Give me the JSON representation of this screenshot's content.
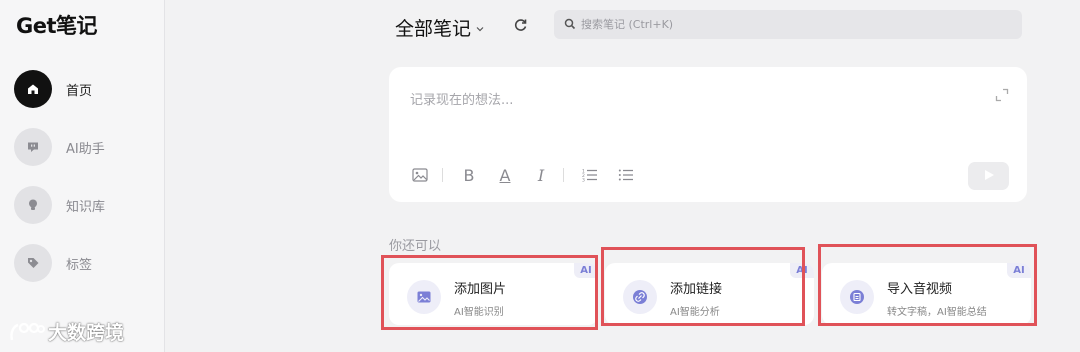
{
  "app": {
    "logo_text": "Get笔记"
  },
  "sidebar": {
    "items": [
      {
        "label": "首页",
        "icon": "home-icon",
        "active": true
      },
      {
        "label": "AI助手",
        "icon": "chat-bot-icon",
        "active": false
      },
      {
        "label": "知识库",
        "icon": "lightbulb-icon",
        "active": false
      },
      {
        "label": "标签",
        "icon": "tag-icon",
        "active": false
      }
    ]
  },
  "header": {
    "title": "全部笔记",
    "title_dropdown_icon": "chevron-down-icon",
    "refresh_icon": "refresh-icon",
    "search": {
      "placeholder": "搜索笔记 (Ctrl+K)",
      "value": ""
    }
  },
  "editor": {
    "placeholder": "记录现在的想法...",
    "toolbar": [
      {
        "name": "image-icon",
        "label": ""
      },
      {
        "name": "bold-icon",
        "label": "B"
      },
      {
        "name": "font-color-icon",
        "label": "A"
      },
      {
        "name": "italic-icon",
        "label": "I"
      },
      {
        "name": "ordered-list-icon",
        "label": ""
      },
      {
        "name": "bullet-list-icon",
        "label": ""
      }
    ],
    "send_icon": "send-icon",
    "expand_icon": "expand-icon"
  },
  "suggestions": {
    "heading": "你还可以",
    "cards": [
      {
        "title": "添加图片",
        "subtitle": "AI智能识别",
        "badge": "AI",
        "icon": "picture-icon"
      },
      {
        "title": "添加链接",
        "subtitle": "AI智能分析",
        "badge": "AI",
        "icon": "link-icon"
      },
      {
        "title": "导入音视频",
        "subtitle": "转文字稿，AI智能总结",
        "badge": "AI",
        "icon": "media-file-icon"
      }
    ]
  },
  "watermark": {
    "text": "大数跨境"
  },
  "colors": {
    "accent": "#7b7fd6",
    "active_nav": "#111111",
    "highlight_box": "#e05258",
    "background": "#f2f2f3"
  }
}
